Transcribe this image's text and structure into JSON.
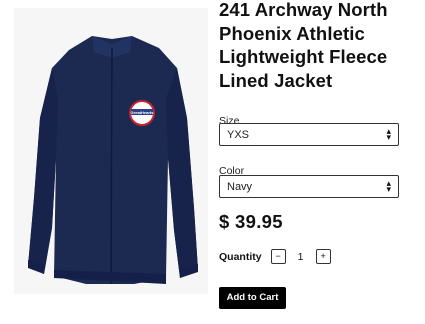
{
  "product": {
    "title": "241 Archway North Phoenix Athletic Lightweight Fleece Lined Jacket",
    "image_alt": "navy jacket with GreatHearts logo patch",
    "logo_text": "GreatHearts",
    "price": "$ 39.95"
  },
  "size": {
    "label": "Size",
    "selected": "YXS"
  },
  "color": {
    "label": "Color",
    "selected": "Navy"
  },
  "quantity": {
    "label": "Quantity",
    "value": "1",
    "minus": "−",
    "plus": "+"
  },
  "actions": {
    "add_to_cart": "Add to Cart"
  },
  "icons": {
    "caret": "up-down-caret-icon"
  },
  "colors": {
    "jacket": "#1c2a52",
    "button": "#000000"
  }
}
